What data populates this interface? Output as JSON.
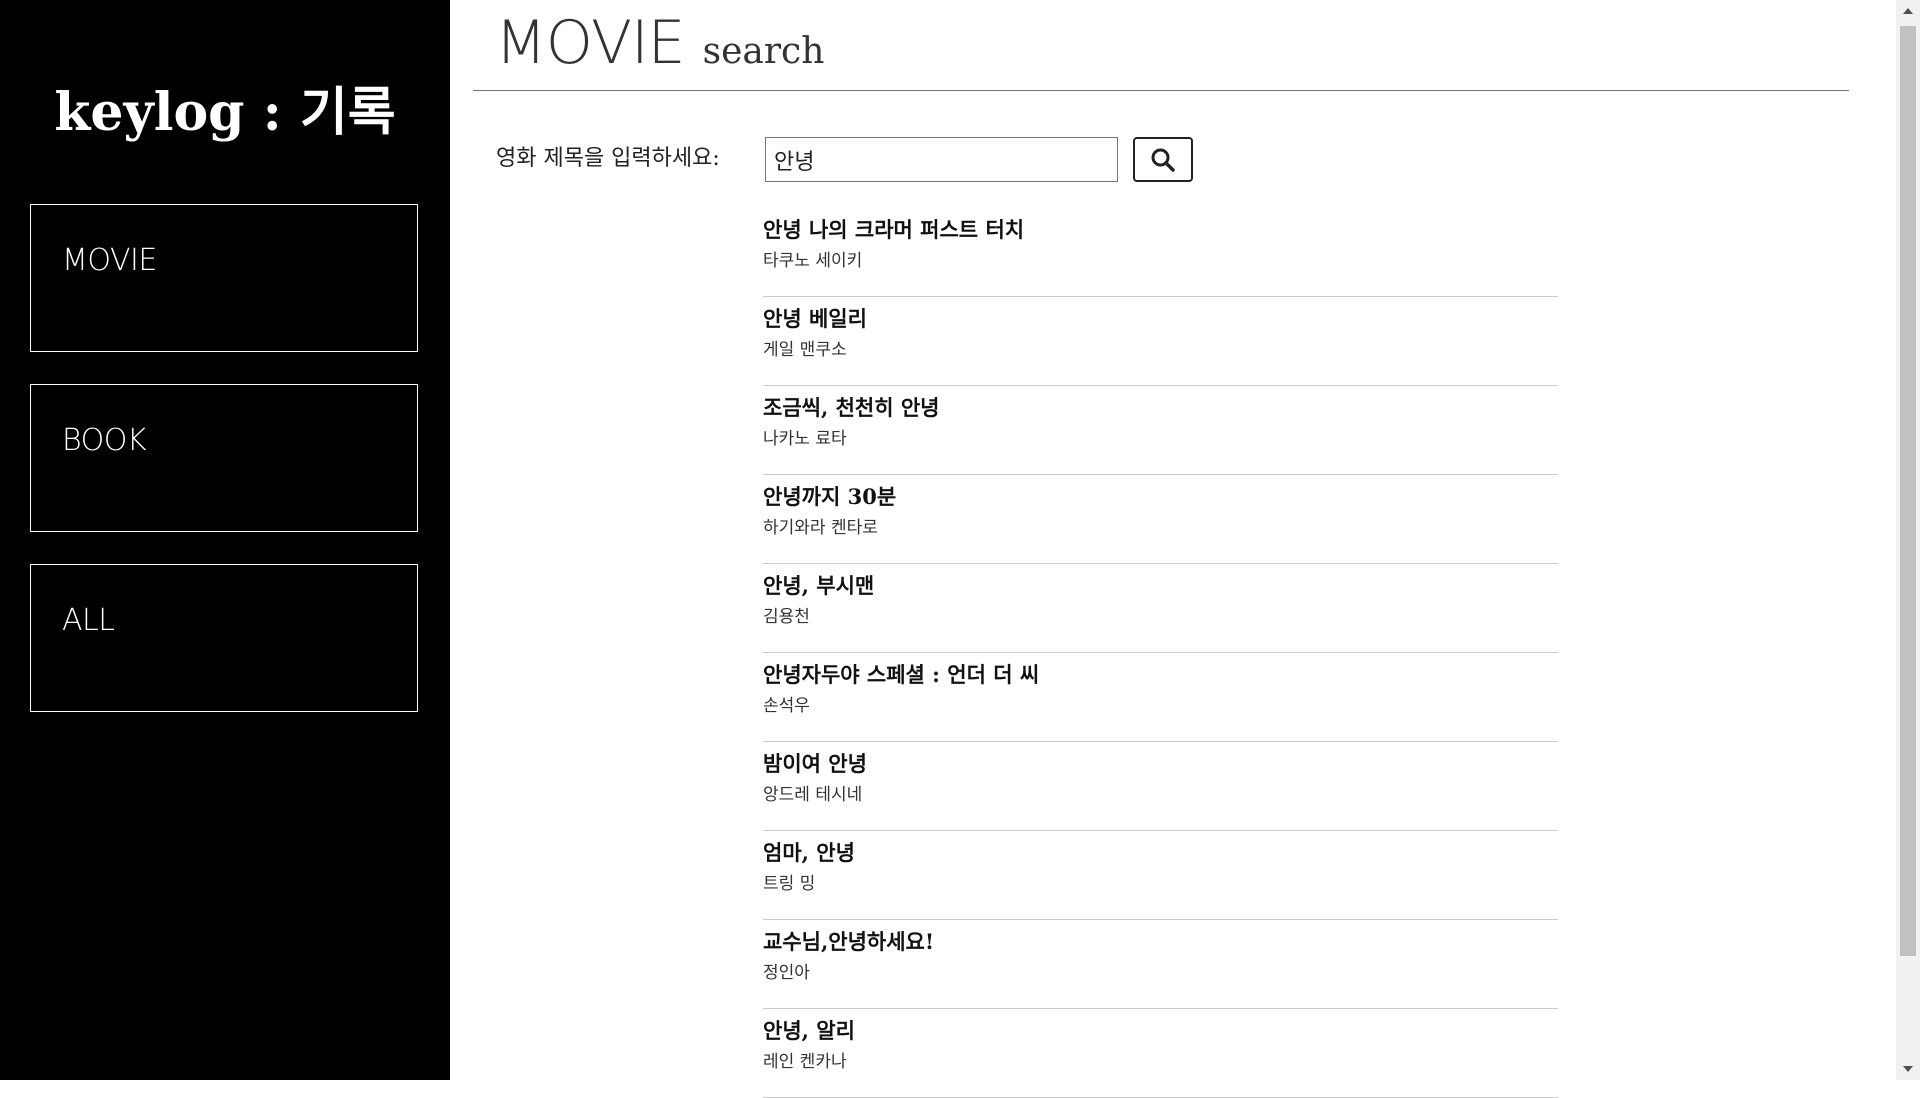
{
  "sidebar": {
    "logo": "keylog : 기록",
    "nav": [
      {
        "label": "MOVIE"
      },
      {
        "label": "BOOK"
      },
      {
        "label": "ALL"
      }
    ]
  },
  "header": {
    "title": "MOVIE",
    "subtitle": "search"
  },
  "search": {
    "label": "영화 제목을 입력하세요:",
    "value": "안녕",
    "button_icon": "search-icon"
  },
  "results": [
    {
      "title": "안녕 나의 크라머 퍼스트 터치",
      "director": "타쿠노 세이키"
    },
    {
      "title": "안녕 베일리",
      "director": "게일 맨쿠소"
    },
    {
      "title": "조금씩, 천천히 안녕",
      "director": "나카노 료타"
    },
    {
      "title": "안녕까지 30분",
      "director": "하기와라 켄타로"
    },
    {
      "title": "안녕, 부시맨",
      "director": "김용천"
    },
    {
      "title": "안녕자두야 스페셜 : 언더 더 씨",
      "director": "손석우"
    },
    {
      "title": "밤이여 안녕",
      "director": "앙드레 테시네"
    },
    {
      "title": "엄마, 안녕",
      "director": "트링 밍"
    },
    {
      "title": "교수님,안녕하세요!",
      "director": "정인아"
    },
    {
      "title": "안녕, 알리",
      "director": "레인 켄카나"
    }
  ],
  "colors": {
    "sidebar_bg": "#000000",
    "sidebar_text": "#ffffff",
    "divider": "#cccccc"
  }
}
